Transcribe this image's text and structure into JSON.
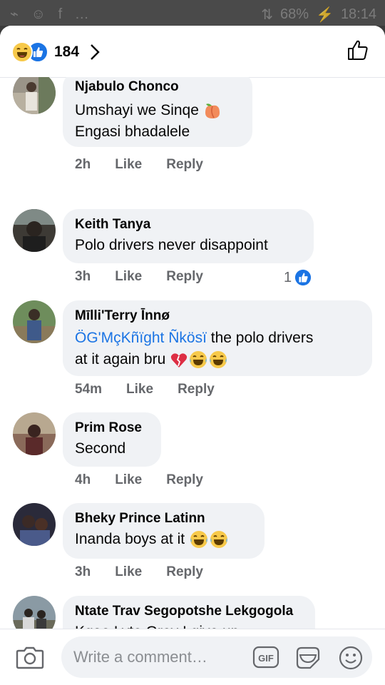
{
  "status_bar": {
    "left_icons": "⌁ ☺ f …",
    "signal": "⇅",
    "battery_pct": "68%",
    "charging_icon": "⚡",
    "time": "18:14"
  },
  "header": {
    "reaction_count": "184"
  },
  "comments": [
    {
      "author": "Njabulo Chonco",
      "text_lines": [
        "Umshayi we Sinqe",
        "Engasi bhadalele"
      ],
      "time": "2h",
      "like": "Like",
      "reply": "Reply"
    },
    {
      "author": "Keith Tanya",
      "text": "Polo drivers never disappoint",
      "time": "3h",
      "like": "Like",
      "reply": "Reply",
      "reactions": "1"
    },
    {
      "author": "Mīlli'Terry Īnnø",
      "mention": "ÖG'MçKñïght Ñkösï",
      "text_after_mention": " the polo drivers",
      "text_line2": "at it again bru",
      "time": "54m",
      "like": "Like",
      "reply": "Reply"
    },
    {
      "author": "Prim  Rose",
      "text": "Second",
      "time": "4h",
      "like": "Like",
      "reply": "Reply"
    },
    {
      "author": "Bheky Prince Latinn",
      "text": "Inanda boys at it ",
      "time": "3h",
      "like": "Like",
      "reply": "Reply"
    },
    {
      "author": "Ntate Trav Segopotshe Lekgogola",
      "text": "Kgao Lyte Grey I give up"
    }
  ],
  "composer": {
    "placeholder": "Write a comment…",
    "gif_label": "GIF"
  },
  "colors": {
    "accent": "#1b74e4",
    "bubble": "#f0f2f5",
    "meta": "#65676b"
  },
  "icons": [
    "haha-emoji-icon",
    "like-reaction-icon",
    "chevron-right-icon",
    "thumbs-up-icon",
    "peach-emoji-icon",
    "broken-heart-icon",
    "tears-of-joy-icon",
    "camera-icon",
    "gif-icon",
    "sticker-icon",
    "smiley-icon"
  ]
}
